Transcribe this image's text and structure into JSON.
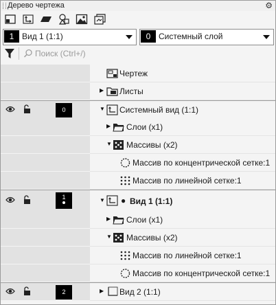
{
  "window": {
    "title": "Дерево чертежа",
    "settings_icon": "gear-icon"
  },
  "toolbar": {
    "buttons": [
      {
        "name": "new-view-button",
        "icon": "view-frame-icon"
      },
      {
        "name": "local-cs-button",
        "icon": "coordinate-system-icon"
      },
      {
        "name": "layer-button",
        "icon": "layer-plane-icon"
      },
      {
        "name": "shapes-button",
        "icon": "shapes-icon"
      },
      {
        "name": "image-button",
        "icon": "image-icon"
      },
      {
        "name": "macro-button",
        "icon": "macro-icon"
      }
    ]
  },
  "view_combo": {
    "number": "1",
    "label": "Вид 1 (1:1)"
  },
  "layer_combo": {
    "number": "0",
    "label": "Системный слой"
  },
  "search": {
    "placeholder": "Поиск (Ctrl+/)"
  },
  "tree": {
    "drawing": "Чертеж",
    "sheets": "Листы",
    "system_view": {
      "badge": "0",
      "label": "Системный вид (1:1)",
      "layers": "Слои (x1)",
      "arrays": "Массивы (x2)",
      "array_items": [
        "Массив по концентрической сетке:1",
        "Массив по линейной сетке:1"
      ]
    },
    "view1": {
      "badge": "1",
      "label": "Вид 1 (1:1)",
      "layers": "Слои (x1)",
      "arrays": "Массивы (x2)",
      "array_items": [
        "Массив по линейной сетке:1",
        "Массив по концентрической сетке:1"
      ]
    },
    "view2": {
      "badge": "2",
      "label": "Вид 2 (1:1)"
    }
  }
}
